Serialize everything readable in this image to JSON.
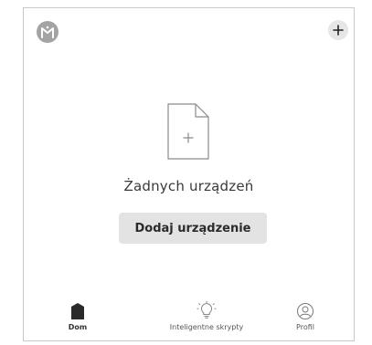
{
  "header": {
    "avatar_icon": "app-logo-icon",
    "add_icon": "plus-icon"
  },
  "empty_state": {
    "icon": "new-document-icon",
    "title": "Żadnych urządzeń",
    "button_label": "Dodaj urządzenie"
  },
  "tabbar": {
    "tabs": [
      {
        "label": "Dom",
        "icon": "home-icon",
        "active": true
      },
      {
        "label": "Inteligentne skrypty",
        "icon": "lightbulb-icon",
        "active": false
      },
      {
        "label": "Profil",
        "icon": "profile-icon",
        "active": false
      }
    ]
  },
  "colors": {
    "avatar": "#a3a3a3",
    "add_button": "#e6e6e6",
    "primary_button": "#e3e3e3",
    "border": "#c9c9c9"
  }
}
